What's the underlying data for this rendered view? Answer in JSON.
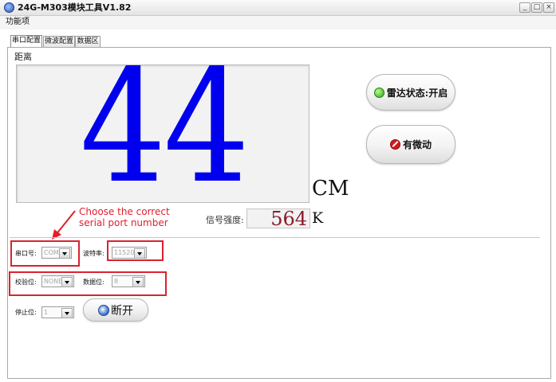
{
  "window": {
    "title": "24G-M303模块工具V1.82"
  },
  "menu": {
    "items": [
      "功能项"
    ]
  },
  "tabs": [
    {
      "label": "串口配置",
      "active": true
    },
    {
      "label": "微波配置",
      "active": false
    },
    {
      "label": "数据区",
      "active": false
    }
  ],
  "distance": {
    "label": "距离",
    "value": "44",
    "unit": "CM"
  },
  "signal": {
    "label": "信号强度:",
    "value": "564",
    "unit": "K"
  },
  "radar_status_button": {
    "label": "雷达状态:开启",
    "status_color": "#2e9f15"
  },
  "motion_button": {
    "label": "有微动",
    "icon_color": "#d11d1d"
  },
  "serial": {
    "port_label": "串口号:",
    "port_value": "COM3",
    "baud_label": "波特率:",
    "baud_value": "115200",
    "parity_label": "校验位:",
    "parity_value": "NONE",
    "databits_label": "数据位:",
    "databits_value": "8",
    "stopbits_label": "停止位:",
    "stopbits_value": "1"
  },
  "disconnect_button": {
    "label": "断开"
  },
  "annotation": {
    "line1": "Choose the correct",
    "line2": "serial port number",
    "color": "#e0202d"
  },
  "colors": {
    "distance_digits": "#0000ee",
    "signal_digits": "#8b1a2b"
  }
}
